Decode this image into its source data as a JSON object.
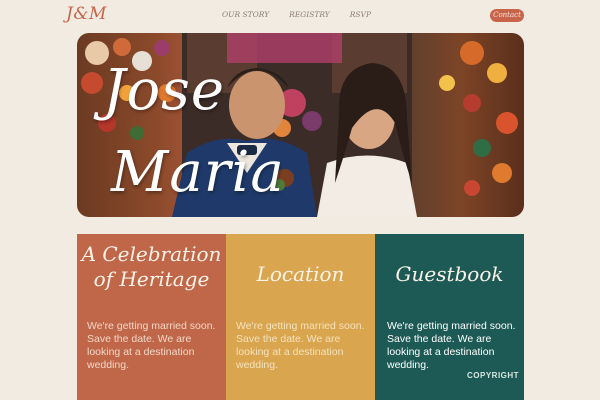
{
  "nav": {
    "logo": "J&M",
    "links": [
      "OUR STORY",
      "REGISTRY",
      "RSVP"
    ],
    "contact_label": "Contact"
  },
  "hero": {
    "name_first": "Jose",
    "name_second": "Maria",
    "photo_description_icon": "couple-photo"
  },
  "cards": [
    {
      "title_line1": "A Celebration",
      "title_line2": "of Heritage",
      "body": "We're getting married soon. Save the date. We are looking at a destination wedding.",
      "color": "#c0674a"
    },
    {
      "title_line1": "Location",
      "body": "We're getting married soon. Save the date. We are looking at a destination wedding.",
      "color": "#d9a54e"
    },
    {
      "title_line1": "Guestbook",
      "body": "We're getting married soon. Save the date. We are looking at a destination wedding.",
      "color": "#1d5a55"
    }
  ],
  "footer": {
    "copyright": "COPYRIGHT"
  },
  "colors": {
    "background": "#f2ebe1",
    "accent": "#c7644a"
  }
}
